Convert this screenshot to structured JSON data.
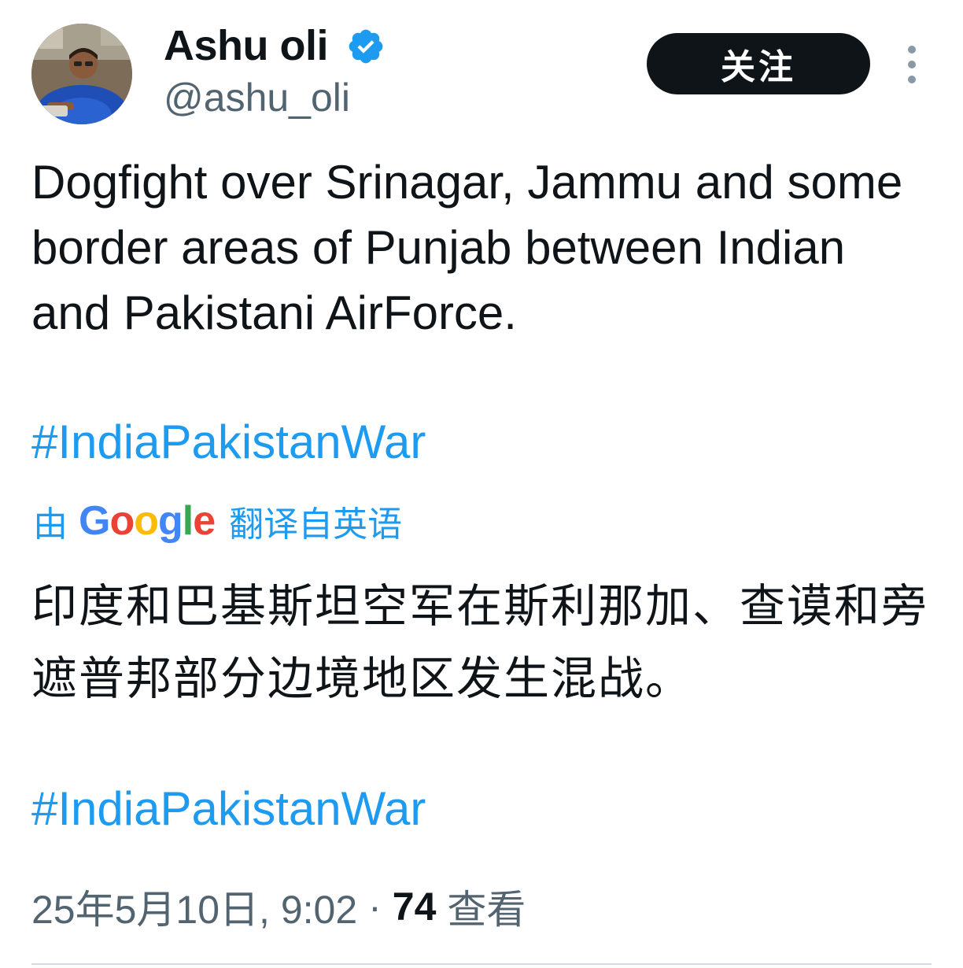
{
  "author": {
    "display_name": "Ashu oli",
    "handle": "@ashu_oli",
    "verified_icon": "verified-badge-icon",
    "verified_color": "#1d9bf0"
  },
  "actions": {
    "follow_label": "关注",
    "more_icon": "more-vertical-icon"
  },
  "tweet": {
    "text": "Dogfight over Srinagar, Jammu and some border areas of Punjab between Indian and Pakistani AirForce.",
    "hashtag": "#IndiaPakistanWar"
  },
  "translation": {
    "prefix": "由",
    "provider": "Google",
    "suffix": "翻译自英语",
    "text": "印度和巴基斯坦空军在斯利那加、查谟和旁遮普邦部分边境地区发生混战。",
    "hashtag": "#IndiaPakistanWar"
  },
  "meta": {
    "timestamp": "25年5月10日, 9:02",
    "separator": "·",
    "views_count": "74",
    "views_label": "查看"
  },
  "colors": {
    "link": "#1d9bf0",
    "text": "#0f1419",
    "secondary": "#536471",
    "button_bg": "#0f1419"
  }
}
